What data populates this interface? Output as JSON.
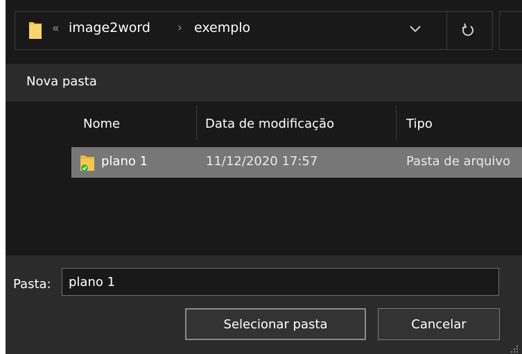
{
  "address_bar": {
    "overflow_label": "«",
    "breadcrumbs": [
      "image2word",
      "exemplo"
    ],
    "separator": "›",
    "dropdown_icon": "chevron-down-icon",
    "refresh_icon": "refresh-icon"
  },
  "command_bar": {
    "new_folder_label": "Nova pasta"
  },
  "file_list": {
    "columns": [
      "Nome",
      "Data de modificação",
      "Tipo"
    ],
    "rows": [
      {
        "name": "plano 1",
        "modified": "11/12/2020 17:57",
        "type": "Pasta de arquivo",
        "selected": true,
        "icon": "folder-synced-icon"
      }
    ]
  },
  "folder_field": {
    "label": "Pasta:",
    "value": "plano 1"
  },
  "buttons": {
    "select_label": "Selecionar pasta",
    "cancel_label": "Cancelar"
  },
  "colors": {
    "background": "#191919",
    "toolbar": "#2b2b2b",
    "selection": "#777777",
    "folder": "#f5c84c",
    "sync_check": "#3fae3f"
  }
}
